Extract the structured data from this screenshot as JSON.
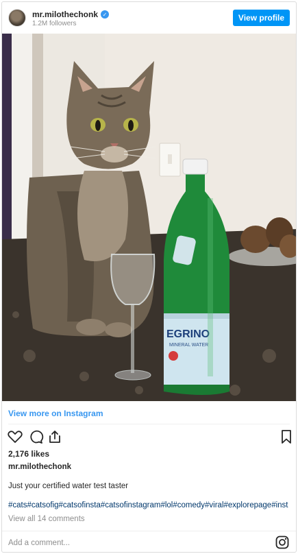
{
  "header": {
    "username": "mr.milothechonk",
    "verified_mark": "✓",
    "followers": "1.2M followers",
    "view_profile_label": "View profile"
  },
  "post": {
    "view_more_label": "View more on Instagram",
    "likes": "2,176 likes",
    "caption_username": "mr.milothechonk",
    "caption": "Just your certified water test taster",
    "hashtags": "#cats#catsofig#catsofinsta#catsofinstagram#lol#comedy#viral#explorepage#inst",
    "view_comments": "View all 14 comments",
    "comment_placeholder": "Add a comment...",
    "bottle_label_brand": "EGRINO",
    "bottle_label_sub": "MINERAL WATER"
  },
  "icons": [
    "verified-badge-icon",
    "heart-icon",
    "comment-icon",
    "share-icon",
    "bookmark-icon",
    "instagram-logo-icon"
  ],
  "colors": {
    "accent": "#0095f6",
    "link": "#3897f0",
    "hashtag": "#00376b",
    "muted": "#8e8e8e"
  }
}
